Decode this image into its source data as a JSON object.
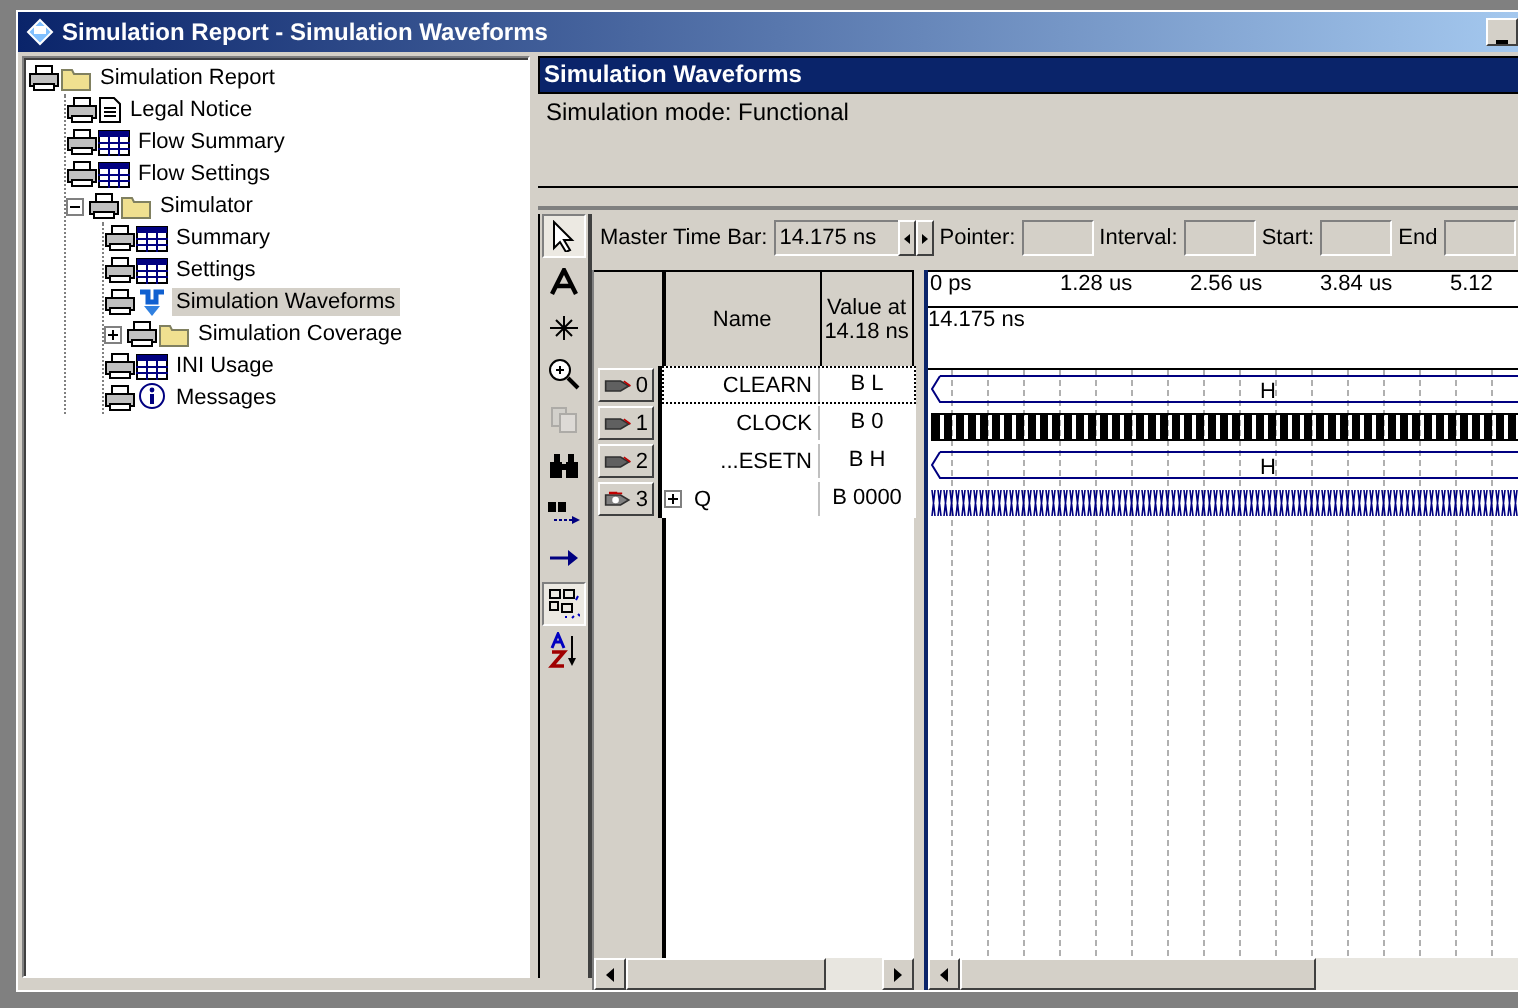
{
  "window": {
    "title": "Simulation Report - Simulation Waveforms"
  },
  "tree": [
    {
      "label": "Simulation Report",
      "kind": "folder",
      "selected": false,
      "children": [
        {
          "label": "Legal Notice",
          "kind": "document",
          "selected": false
        },
        {
          "label": "Flow Summary",
          "kind": "table",
          "selected": false
        },
        {
          "label": "Flow Settings",
          "kind": "table",
          "selected": false
        },
        {
          "label": "Simulator",
          "kind": "folder",
          "selected": false,
          "expanded": true,
          "children": [
            {
              "label": "Summary",
              "kind": "table",
              "selected": false
            },
            {
              "label": "Settings",
              "kind": "table",
              "selected": false
            },
            {
              "label": "Simulation Waveforms",
              "kind": "waveform",
              "selected": true
            },
            {
              "label": "Simulation Coverage",
              "kind": "folder",
              "selected": false,
              "expanded": false
            },
            {
              "label": "INI Usage",
              "kind": "table",
              "selected": false
            },
            {
              "label": "Messages",
              "kind": "info",
              "selected": false
            }
          ]
        }
      ]
    }
  ],
  "panel": {
    "title": "Simulation Waveforms",
    "text": "Simulation mode: Functional"
  },
  "toolbar": [
    {
      "kind": "pointer",
      "pressed": true,
      "disabled": false
    },
    {
      "kind": "text",
      "pressed": false,
      "disabled": false
    },
    {
      "kind": "node",
      "pressed": false,
      "disabled": false
    },
    {
      "kind": "zoom",
      "pressed": false,
      "disabled": false
    },
    {
      "kind": "copy",
      "pressed": false,
      "disabled": true
    },
    {
      "kind": "find",
      "pressed": false,
      "disabled": false
    },
    {
      "kind": "findnext",
      "pressed": false,
      "disabled": false
    },
    {
      "kind": "arrow",
      "pressed": false,
      "disabled": false
    },
    {
      "kind": "group",
      "pressed": true,
      "disabled": false
    },
    {
      "kind": "sort",
      "pressed": false,
      "disabled": false
    }
  ],
  "timebar": {
    "label": "Master Time Bar:",
    "value": "14.175 ns",
    "fields": [
      {
        "label": "Pointer:"
      },
      {
        "label": "Interval:"
      },
      {
        "label": "Start:"
      },
      {
        "label": "End"
      }
    ]
  },
  "table": {
    "columns": [
      {
        "label": "Name"
      },
      {
        "label": "Value at 14.18 ns"
      }
    ],
    "rows": [
      {
        "index": "0",
        "kind": "input",
        "name": "CLEARN",
        "value": "B L",
        "wave": {
          "kind": "level",
          "label": "H"
        },
        "selected": true
      },
      {
        "index": "1",
        "kind": "input",
        "name": "CLOCK",
        "value": "B 0",
        "wave": {
          "kind": "clock"
        },
        "selected": false
      },
      {
        "index": "2",
        "kind": "input",
        "name": "...ESETN",
        "value": "B H",
        "wave": {
          "kind": "level",
          "label": "H"
        },
        "selected": false
      },
      {
        "index": "3",
        "kind": "output",
        "name": "Q",
        "value": "B 0000",
        "wave": {
          "kind": "counter"
        },
        "selected": false,
        "expanded": false
      }
    ]
  },
  "ruler": {
    "ticks": [
      "0 ps",
      "1.28 us",
      "2.56 us",
      "3.84 us",
      "5.12"
    ],
    "cursor": "14.175 ns"
  }
}
